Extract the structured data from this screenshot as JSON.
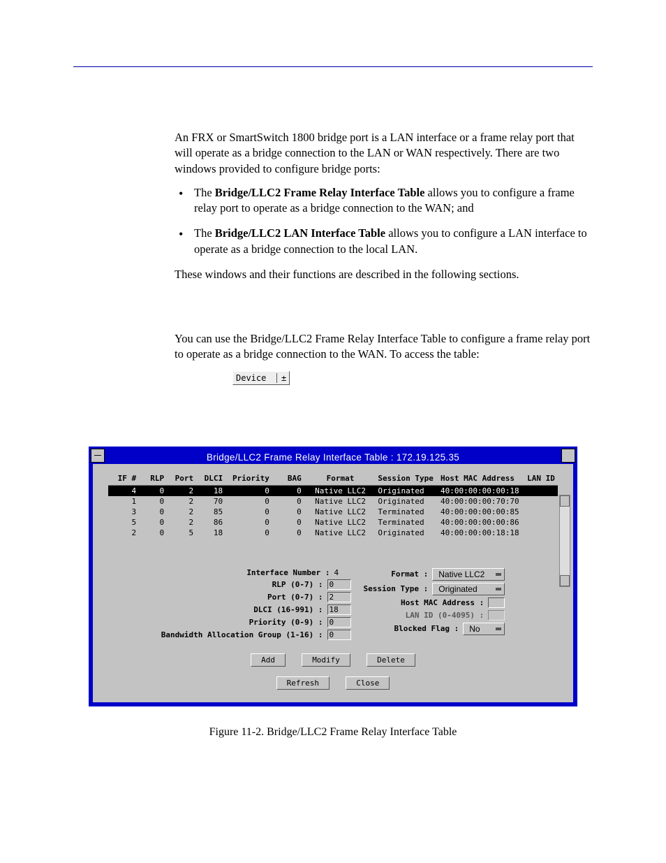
{
  "para1": "An FRX or SmartSwitch 1800 bridge port is a LAN interface or a frame relay port that will operate as a bridge connection to the LAN or WAN respectively. There are two windows provided to configure bridge ports:",
  "bullet1_prefix": "The ",
  "bullet1_bold": "Bridge/LLC2 Frame Relay Interface Table",
  "bullet1_suffix": " allows you to configure a frame relay port to operate as a bridge connection to the WAN; and",
  "bullet2_prefix": "The ",
  "bullet2_bold": "Bridge/LLC2 LAN Interface Table",
  "bullet2_suffix": " allows you to configure a LAN interface to operate as a bridge connection to the local LAN.",
  "para2": "These windows and their functions are described in the following sections.",
  "para3": "You can use the Bridge/LLC2 Frame Relay Interface Table to configure a frame relay port to operate as a bridge connection to the WAN. To access the table:",
  "device_label": "Device",
  "device_toggle": "±",
  "dialog_title": "Bridge/LLC2 Frame Relay Interface Table : 172.19.125.35",
  "headers": {
    "if": "IF #",
    "rlp": "RLP",
    "port": "Port",
    "dlci": "DLCI",
    "priority": "Priority",
    "bag": "BAG",
    "format": "Format",
    "session": "Session Type",
    "mac": "Host MAC Address",
    "lan": "LAN ID"
  },
  "rows": [
    {
      "if": "4",
      "rlp": "0",
      "port": "2",
      "dlci": "18",
      "prio": "0",
      "bag": "0",
      "fmt": "Native LLC2",
      "sess": "Originated",
      "mac": "40:00:00:00:00:18",
      "lan": "",
      "hl": true
    },
    {
      "if": "1",
      "rlp": "0",
      "port": "2",
      "dlci": "70",
      "prio": "0",
      "bag": "0",
      "fmt": "Native LLC2",
      "sess": "Originated",
      "mac": "40:00:00:00:70:70",
      "lan": "",
      "hl": false
    },
    {
      "if": "3",
      "rlp": "0",
      "port": "2",
      "dlci": "85",
      "prio": "0",
      "bag": "0",
      "fmt": "Native LLC2",
      "sess": "Terminated",
      "mac": "40:00:00:00:00:85",
      "lan": "",
      "hl": false
    },
    {
      "if": "5",
      "rlp": "0",
      "port": "2",
      "dlci": "86",
      "prio": "0",
      "bag": "0",
      "fmt": "Native LLC2",
      "sess": "Terminated",
      "mac": "40:00:00:00:00:86",
      "lan": "",
      "hl": false
    },
    {
      "if": "2",
      "rlp": "0",
      "port": "5",
      "dlci": "18",
      "prio": "0",
      "bag": "0",
      "fmt": "Native LLC2",
      "sess": "Originated",
      "mac": "40:00:00:00:18:18",
      "lan": "",
      "hl": false
    }
  ],
  "form": {
    "interface_number_label": "Interface Number :",
    "interface_number_value": "4",
    "rlp_label": "RLP (0-7) :",
    "rlp_value": "0",
    "port_label": "Port (0-7) :",
    "port_value": "2",
    "dlci_label": "DLCI (16-991) :",
    "dlci_value": "18",
    "priority_label": "Priority (0-9) :",
    "priority_value": "0",
    "bag_label": "Bandwidth Allocation Group (1-16) :",
    "bag_value": "0",
    "format_label": "Format :",
    "format_value": "Native LLC2",
    "session_label": "Session Type :",
    "session_value": "Originated",
    "hostmac_label": "Host MAC Address :",
    "hostmac_value": "",
    "lanid_label": "LAN ID (0-4095) :",
    "lanid_value": "",
    "blocked_label": "Blocked Flag :",
    "blocked_value": "No"
  },
  "buttons": {
    "add": "Add",
    "modify": "Modify",
    "delete": "Delete",
    "refresh": "Refresh",
    "close": "Close"
  },
  "figure_caption": "Figure 11-2. Bridge/LLC2 Frame Relay Interface Table"
}
